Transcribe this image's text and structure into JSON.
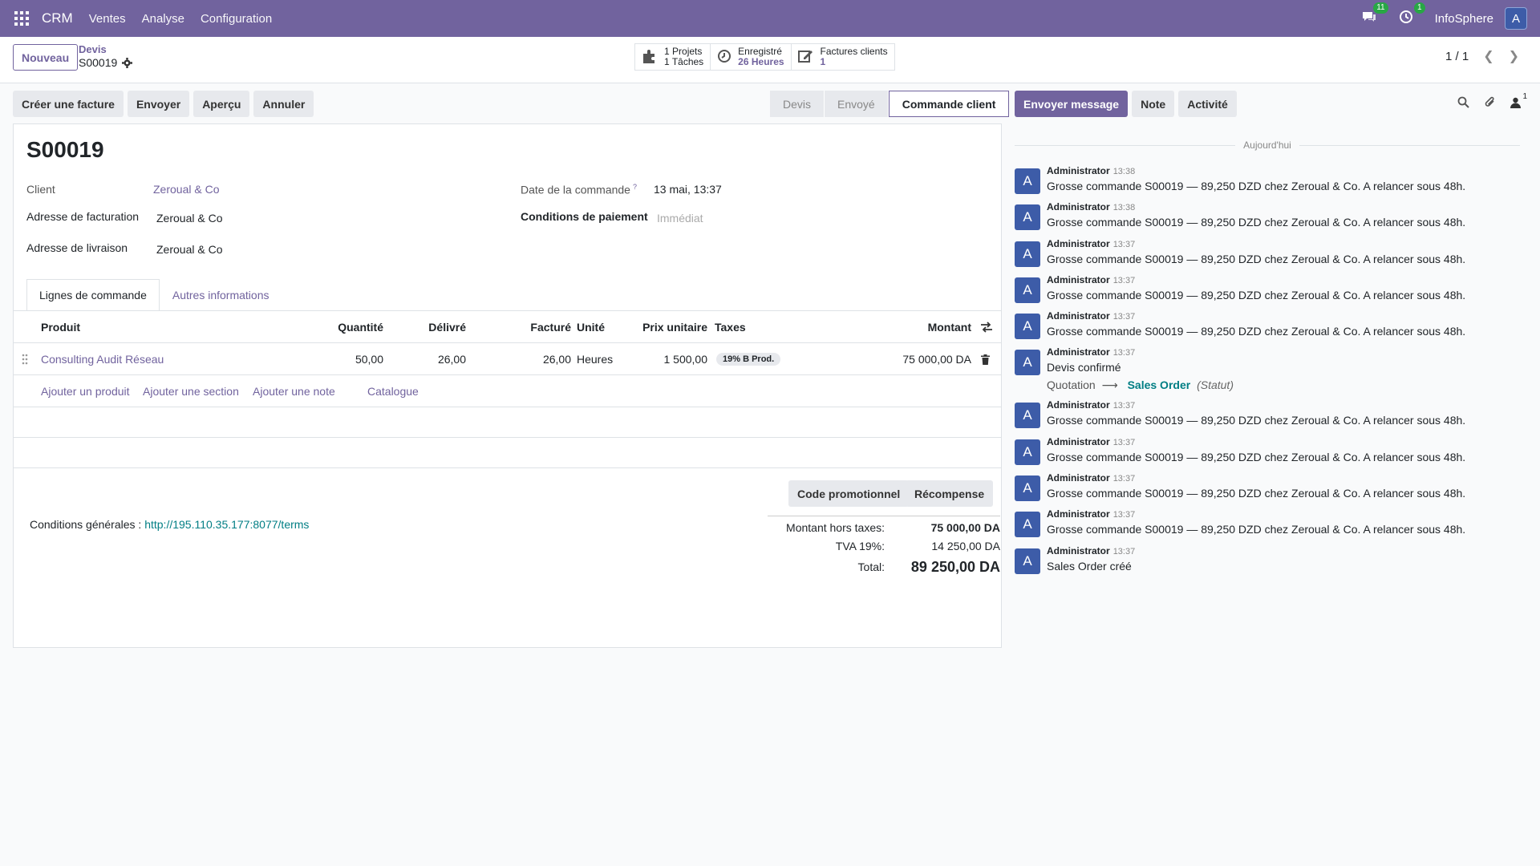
{
  "topbar": {
    "app": "CRM",
    "menus": [
      "Ventes",
      "Analyse",
      "Configuration"
    ],
    "messages_count": "11",
    "activities_count": "1",
    "company": "InfoSphere",
    "avatar_letter": "A"
  },
  "control": {
    "new_label": "Nouveau",
    "breadcrumb_parent": "Devis",
    "breadcrumb_current": "S00019",
    "smart_buttons": {
      "projects_count": "1",
      "projects_label": "Projets",
      "tasks_count": "1",
      "tasks_label": "Tâches",
      "recorded_label": "Enregistré",
      "recorded_value": "26 Heures",
      "invoices_label": "Factures clients",
      "invoices_value": "1"
    },
    "pager": "1 / 1"
  },
  "actions": [
    "Créer une facture",
    "Envoyer",
    "Aperçu",
    "Annuler"
  ],
  "statusbar": [
    "Devis",
    "Envoyé",
    "Commande client"
  ],
  "form": {
    "title": "S00019",
    "client_label": "Client",
    "client_value": "Zeroual & Co",
    "billing_label": "Adresse de facturation",
    "billing_value": "Zeroual & Co",
    "shipping_label": "Adresse de livraison",
    "shipping_value": "Zeroual & Co",
    "date_label": "Date de la commande",
    "date_help": "?",
    "date_value": "13 mai, 13:37",
    "payment_label": "Conditions de paiement",
    "payment_placeholder": "Immédiat"
  },
  "tabs": [
    "Lignes de commande",
    "Autres informations"
  ],
  "table": {
    "headers": {
      "product": "Produit",
      "qty": "Quantité",
      "delivered": "Délivré",
      "invoiced": "Facturé",
      "unit": "Unité",
      "price": "Prix unitaire",
      "taxes": "Taxes",
      "amount": "Montant"
    },
    "rows": [
      {
        "product": "Consulting Audit Réseau",
        "qty": "50,00",
        "delivered": "26,00",
        "invoiced": "26,00",
        "unit": "Heures",
        "price": "1 500,00",
        "tax": "19% B Prod.",
        "amount": "75 000,00 DA"
      }
    ],
    "add_links": [
      "Ajouter un produit",
      "Ajouter une section",
      "Ajouter une note",
      "Catalogue"
    ]
  },
  "promo": {
    "code_label": "Code promotionnel",
    "reward_label": "Récompense"
  },
  "terms": {
    "label": "Conditions générales :",
    "link": "http://195.110.35.177:8077/terms"
  },
  "totals": {
    "untaxed_label": "Montant hors taxes:",
    "untaxed_value": "75 000,00 DA",
    "tax_label": "TVA 19%:",
    "tax_value": "14 250,00 DA",
    "total_label": "Total:",
    "total_value": "89 250,00 DA"
  },
  "chatter": {
    "send_message": "Envoyer message",
    "note": "Note",
    "activity": "Activité",
    "followers_count": "1",
    "today_label": "Aujourd'hui",
    "messages": [
      {
        "author": "Administrator",
        "time": "13:38",
        "body": "Grosse commande S00019 — 89,250 DZD chez Zeroual & Co. A relancer sous 48h."
      },
      {
        "author": "Administrator",
        "time": "13:38",
        "body": "Grosse commande S00019 — 89,250 DZD chez Zeroual & Co. A relancer sous 48h."
      },
      {
        "author": "Administrator",
        "time": "13:37",
        "body": "Grosse commande S00019 — 89,250 DZD chez Zeroual & Co. A relancer sous 48h."
      },
      {
        "author": "Administrator",
        "time": "13:37",
        "body": "Grosse commande S00019 — 89,250 DZD chez Zeroual & Co. A relancer sous 48h."
      },
      {
        "author": "Administrator",
        "time": "13:37",
        "body": "Grosse commande S00019 — 89,250 DZD chez Zeroual & Co. A relancer sous 48h."
      },
      {
        "author": "Administrator",
        "time": "13:37",
        "body": "Devis confirmé",
        "tracking_from": "Quotation",
        "tracking_to": "Sales Order",
        "tracking_field": "(Statut)"
      },
      {
        "author": "Administrator",
        "time": "13:37",
        "body": "Grosse commande S00019 — 89,250 DZD chez Zeroual & Co. A relancer sous 48h."
      },
      {
        "author": "Administrator",
        "time": "13:37",
        "body": "Grosse commande S00019 — 89,250 DZD chez Zeroual & Co. A relancer sous 48h."
      },
      {
        "author": "Administrator",
        "time": "13:37",
        "body": "Grosse commande S00019 — 89,250 DZD chez Zeroual & Co. A relancer sous 48h."
      },
      {
        "author": "Administrator",
        "time": "13:37",
        "body": "Grosse commande S00019 — 89,250 DZD chez Zeroual & Co. A relancer sous 48h."
      },
      {
        "author": "Administrator",
        "time": "13:37",
        "body": "Sales Order créé"
      }
    ]
  },
  "colors": {
    "brand": "#71639e",
    "avatar": "#3d5ca8",
    "teal_link": "#017e84",
    "badge_green": "#28a745"
  }
}
